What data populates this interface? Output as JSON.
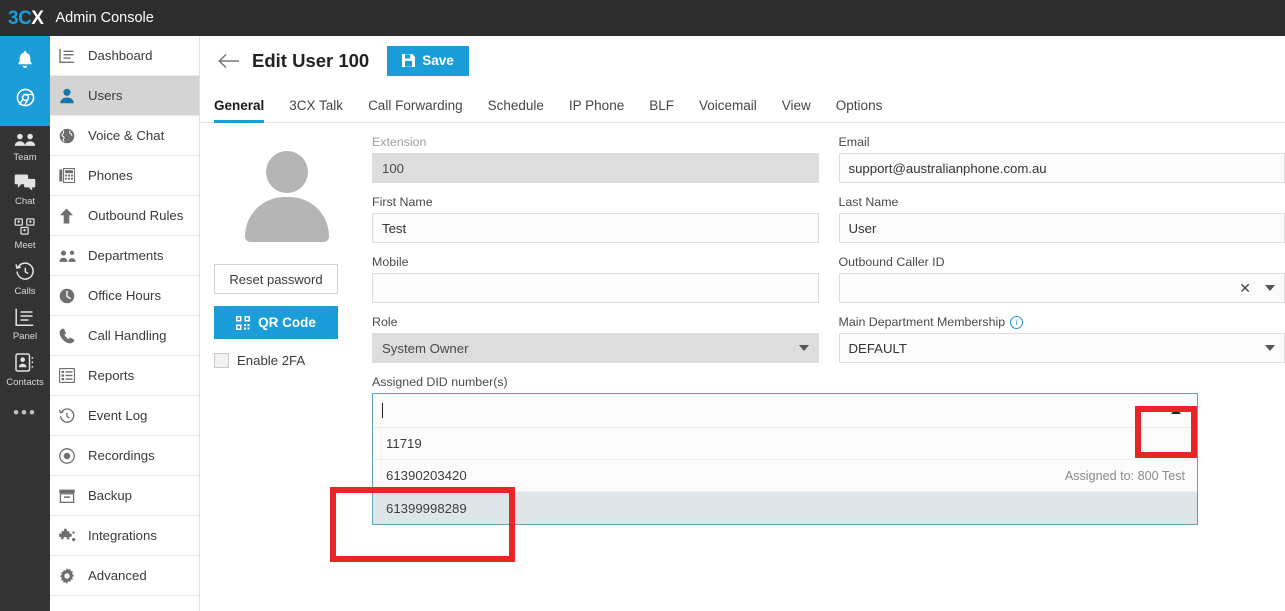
{
  "topbar": {
    "logo_3": "3C",
    "logo_x": "X",
    "title": "Admin Console"
  },
  "rail": {
    "top_icons": [
      {
        "name": "bell-icon",
        "label": "Notifications"
      },
      {
        "name": "browser-icon",
        "label": "Web Client"
      }
    ],
    "items": [
      {
        "label": "Team",
        "icon": "team-icon"
      },
      {
        "label": "Chat",
        "icon": "chat-icon"
      },
      {
        "label": "Meet",
        "icon": "meet-icon"
      },
      {
        "label": "Calls",
        "icon": "calls-icon"
      },
      {
        "label": "Panel",
        "icon": "panel-icon"
      },
      {
        "label": "Contacts",
        "icon": "contacts-icon"
      }
    ],
    "more": "•••"
  },
  "sidebar": {
    "items": [
      {
        "label": "Dashboard",
        "icon": "dashboard-icon",
        "active": false
      },
      {
        "label": "Users",
        "icon": "user-icon",
        "active": true
      },
      {
        "label": "Voice & Chat",
        "icon": "globe-icon",
        "active": false
      },
      {
        "label": "Phones",
        "icon": "phone-device-icon",
        "active": false
      },
      {
        "label": "Outbound Rules",
        "icon": "arrow-up-icon",
        "active": false
      },
      {
        "label": "Departments",
        "icon": "departments-icon",
        "active": false
      },
      {
        "label": "Office Hours",
        "icon": "clock-icon",
        "active": false
      },
      {
        "label": "Call Handling",
        "icon": "handset-icon",
        "active": false
      },
      {
        "label": "Reports",
        "icon": "reports-icon",
        "active": false
      },
      {
        "label": "Event Log",
        "icon": "history-icon",
        "active": false
      },
      {
        "label": "Recordings",
        "icon": "record-icon",
        "active": false
      },
      {
        "label": "Backup",
        "icon": "backup-icon",
        "active": false
      },
      {
        "label": "Integrations",
        "icon": "puzzle-icon",
        "active": false
      },
      {
        "label": "Advanced",
        "icon": "gear-icon",
        "active": false
      }
    ]
  },
  "header": {
    "back_icon": "back-arrow-icon",
    "title": "Edit User 100",
    "save_label": "Save",
    "save_icon": "floppy-disk-icon"
  },
  "tabs": [
    {
      "label": "General",
      "active": true
    },
    {
      "label": "3CX Talk",
      "active": false
    },
    {
      "label": "Call Forwarding",
      "active": false
    },
    {
      "label": "Schedule",
      "active": false
    },
    {
      "label": "IP Phone",
      "active": false
    },
    {
      "label": "BLF",
      "active": false
    },
    {
      "label": "Voicemail",
      "active": false
    },
    {
      "label": "View",
      "active": false
    },
    {
      "label": "Options",
      "active": false
    }
  ],
  "profile": {
    "avatar_icon": "user-avatar-icon",
    "reset_password_label": "Reset password",
    "qr_code_label": "QR Code",
    "qr_icon": "qr-code-icon",
    "enable_2fa_label": "Enable 2FA",
    "enable_2fa_checked": false
  },
  "form": {
    "extension": {
      "label": "Extension",
      "value": "100",
      "readonly": true
    },
    "email": {
      "label": "Email",
      "value": "support@australianphone.com.au"
    },
    "first_name": {
      "label": "First Name",
      "value": "Test"
    },
    "last_name": {
      "label": "Last Name",
      "value": "User"
    },
    "mobile": {
      "label": "Mobile",
      "value": ""
    },
    "outbound_caller_id": {
      "label": "Outbound Caller ID",
      "value": "",
      "clear_icon": "clear-x-icon",
      "caret_icon": "chevron-down-icon"
    },
    "role": {
      "label": "Role",
      "value": "System Owner",
      "readonly": true,
      "caret_icon": "chevron-down-icon"
    },
    "main_department": {
      "label": "Main Department Membership",
      "info_icon": "info-icon",
      "value": "DEFAULT",
      "caret_icon": "chevron-down-icon"
    },
    "assigned_did": {
      "label": "Assigned DID number(s)",
      "input_value": "",
      "expanded": true,
      "toggle_icon": "chevron-up-icon",
      "options": [
        {
          "number": "11719",
          "assigned_to": "",
          "highlighted": false
        },
        {
          "number": "61390203420",
          "assigned_to": "Assigned to: 800 Test",
          "highlighted": false
        },
        {
          "number": "61399998289",
          "assigned_to": "",
          "highlighted": true
        }
      ]
    }
  },
  "annotations": [
    {
      "name": "dropdown-toggle-highlight",
      "color": "#e8262a"
    },
    {
      "name": "did-option-highlight",
      "color": "#e8262a"
    }
  ]
}
